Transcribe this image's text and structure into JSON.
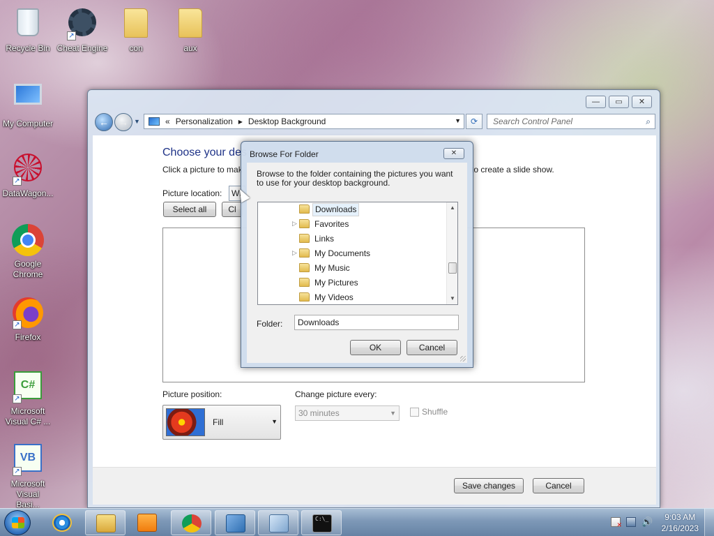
{
  "desktop": {
    "icons": [
      {
        "label": "Recycle Bin",
        "icon": "recycle-bin-icon"
      },
      {
        "label": "Cheat Engine",
        "icon": "cheat-engine-icon"
      },
      {
        "label": "con",
        "icon": "folder-icon"
      },
      {
        "label": "aux",
        "icon": "folder-icon"
      },
      {
        "label": "My Computer",
        "icon": "computer-icon"
      },
      {
        "label": "DataWagon...",
        "icon": "datawagon-icon"
      },
      {
        "label": "Google Chrome",
        "icon": "chrome-icon"
      },
      {
        "label": "Firefox",
        "icon": "firefox-icon"
      },
      {
        "label": "Microsoft Visual C# ...",
        "icon": "visual-csharp-icon",
        "glyph": "C#"
      },
      {
        "label": "Microsoft Visual Basi...",
        "icon": "visual-basic-icon",
        "glyph": "VB"
      }
    ]
  },
  "window": {
    "controls": {
      "minimize": "—",
      "maximize": "▭",
      "close": "✕"
    },
    "address": {
      "back": "←",
      "forward": "→",
      "prefix": "«",
      "crumbs": [
        "Personalization",
        "Desktop Background"
      ],
      "separator": "▶",
      "dropdown": "▼",
      "refresh": "⟳"
    },
    "search": {
      "placeholder": "Search Control Panel",
      "icon": "⌕"
    },
    "content": {
      "title": "Choose your des",
      "desc_start": "Click a picture to mak",
      "desc_end": "to create a slide show.",
      "picture_location_label": "Picture location:",
      "picture_location_value": "Wi",
      "select_all": "Select all",
      "clear_all": "Cl",
      "picture_position_label": "Picture position:",
      "picture_position_value": "Fill",
      "change_every_label": "Change picture every:",
      "change_every_value": "30 minutes",
      "shuffle_label": "Shuffle"
    },
    "footer": {
      "save": "Save changes",
      "cancel": "Cancel"
    }
  },
  "dialog": {
    "title": "Browse For Folder",
    "close": "✕",
    "instructions": "Browse to the folder containing the pictures you want to use for your desktop background.",
    "tree": [
      {
        "label": "Downloads",
        "expander": "",
        "selected": true
      },
      {
        "label": "Favorites",
        "expander": "▷",
        "selected": false
      },
      {
        "label": "Links",
        "expander": "",
        "selected": false
      },
      {
        "label": "My Documents",
        "expander": "▷",
        "selected": false
      },
      {
        "label": "My Music",
        "expander": "",
        "selected": false
      },
      {
        "label": "My Pictures",
        "expander": "",
        "selected": false
      },
      {
        "label": "My Videos",
        "expander": "",
        "selected": false
      }
    ],
    "scroll": {
      "up": "▲",
      "down": "▼"
    },
    "folder_label": "Folder:",
    "folder_value": "Downloads",
    "ok": "OK",
    "cancel": "Cancel"
  },
  "taskbar": {
    "cmd_text": "C:\\_",
    "clock_time": "9:03 AM",
    "clock_date": "2/16/2023",
    "volume": "🔊"
  }
}
